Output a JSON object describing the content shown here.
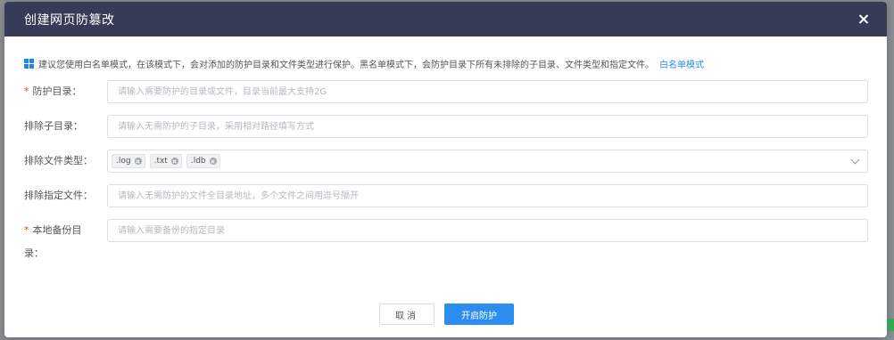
{
  "dialog": {
    "title": "创建网页防篡改",
    "close_icon": "close-icon"
  },
  "tip": {
    "icon": "windows-icon",
    "text": "建议您使用白名单模式，在该模式下，会对添加的防护目录和文件类型进行保护。黑名单模式下，会防护目录下所有未排除的子目录、文件类型和指定文件。",
    "link": "白名单模式"
  },
  "form": {
    "protect_dir": {
      "required": "*",
      "label": "防护目录：",
      "placeholder": "请输入需要防护的目录或文件，目录当前最大支持2G"
    },
    "exclude_subdir": {
      "label": "排除子目录：",
      "placeholder": "请输入无需防护的子目录，采用相对路径填写方式"
    },
    "exclude_filetypes": {
      "label": "排除文件类型：",
      "tags": [
        ".log",
        ".txt",
        ".ldb"
      ]
    },
    "exclude_files": {
      "label": "排除指定文件：",
      "placeholder": "请输入无需防护的文件全目录地址，多个文件之间用逗号隔开"
    },
    "backup_dir": {
      "required": "*",
      "label_line1": "本地备份目",
      "label_line2": "录：",
      "placeholder": "请输入需要备份的指定目录"
    }
  },
  "buttons": {
    "cancel": "取消",
    "confirm": "开启防护"
  },
  "colors": {
    "header_bg": "#363b57",
    "primary": "#2d8cf0",
    "required": "#ed4014"
  }
}
